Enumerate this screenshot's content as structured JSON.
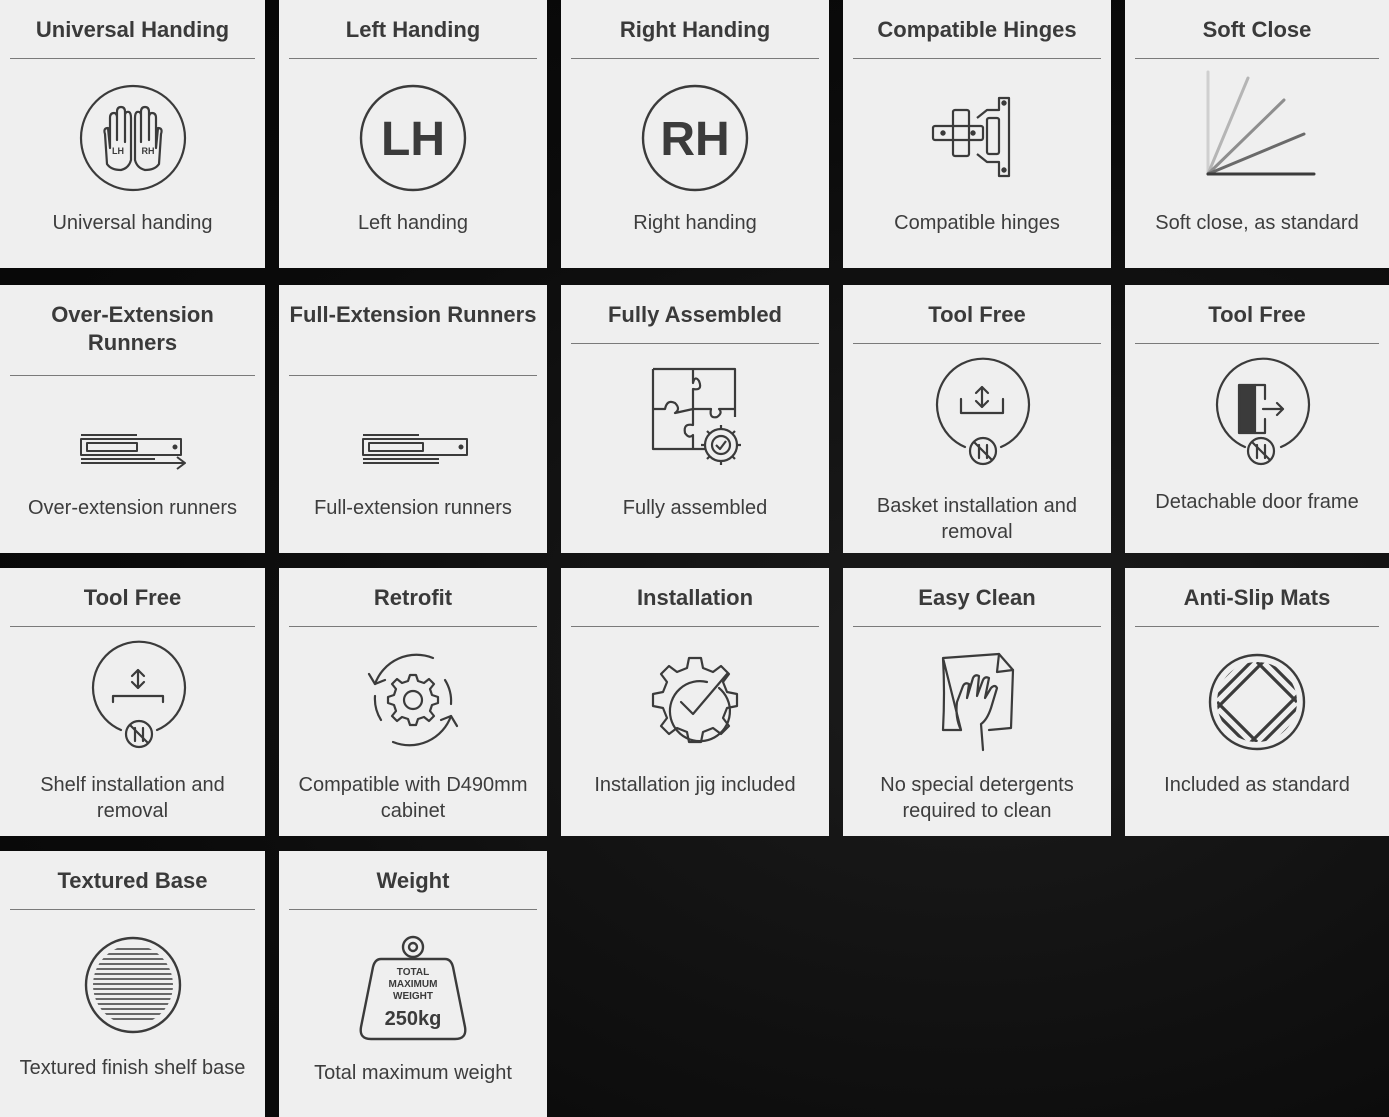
{
  "cards": [
    {
      "title": "Universal Handing",
      "desc": "Universal handing",
      "icon": "hands-icon"
    },
    {
      "title": "Left Handing",
      "desc": "Left handing",
      "icon": "lh-circle-icon"
    },
    {
      "title": "Right Handing",
      "desc": "Right handing",
      "icon": "rh-circle-icon"
    },
    {
      "title": "Compatible Hinges",
      "desc": "Compatible hinges",
      "icon": "hinge-icon"
    },
    {
      "title": "Soft Close",
      "desc": "Soft close, as standard",
      "icon": "soft-close-icon"
    },
    {
      "title": "Over-Extension Runners",
      "desc": "Over-extension runners",
      "icon": "over-extension-runner-icon"
    },
    {
      "title": "Full-Extension Runners",
      "desc": "Full-extension runners",
      "icon": "full-extension-runner-icon"
    },
    {
      "title": "Fully Assembled",
      "desc": "Fully assembled",
      "icon": "puzzle-gear-icon"
    },
    {
      "title": "Tool Free",
      "desc": "Basket installation and removal",
      "icon": "basket-tool-free-icon"
    },
    {
      "title": "Tool Free",
      "desc": "Detachable door frame",
      "icon": "door-tool-free-icon"
    },
    {
      "title": "Tool Free",
      "desc": "Shelf installation and removal",
      "icon": "shelf-tool-free-icon"
    },
    {
      "title": "Retrofit",
      "desc": "Compatible with D490mm cabinet",
      "icon": "retrofit-gear-icon"
    },
    {
      "title": "Installation",
      "desc": "Installation jig included",
      "icon": "gear-check-icon"
    },
    {
      "title": "Easy Clean",
      "desc": "No special detergents required to clean",
      "icon": "cloth-hand-icon"
    },
    {
      "title": "Anti-Slip Mats",
      "desc": "Included as standard",
      "icon": "anti-slip-mat-icon"
    },
    {
      "title": "Textured Base",
      "desc": "Textured finish shelf base",
      "icon": "textured-base-icon"
    },
    {
      "title": "Weight",
      "desc": "Total maximum weight",
      "icon": "weight-icon"
    }
  ],
  "icon_text": {
    "lh": "LH",
    "rh": "RH",
    "hands_lh": "LH",
    "hands_rh": "RH",
    "weight_line1": "TOTAL",
    "weight_line2": "MAXIMUM",
    "weight_line3": "WEIGHT",
    "weight_value": "250kg"
  },
  "colors": {
    "card_bg": "#efefef",
    "icon_stroke": "#3b3b3b",
    "page_bg": "#0d0d0d"
  }
}
